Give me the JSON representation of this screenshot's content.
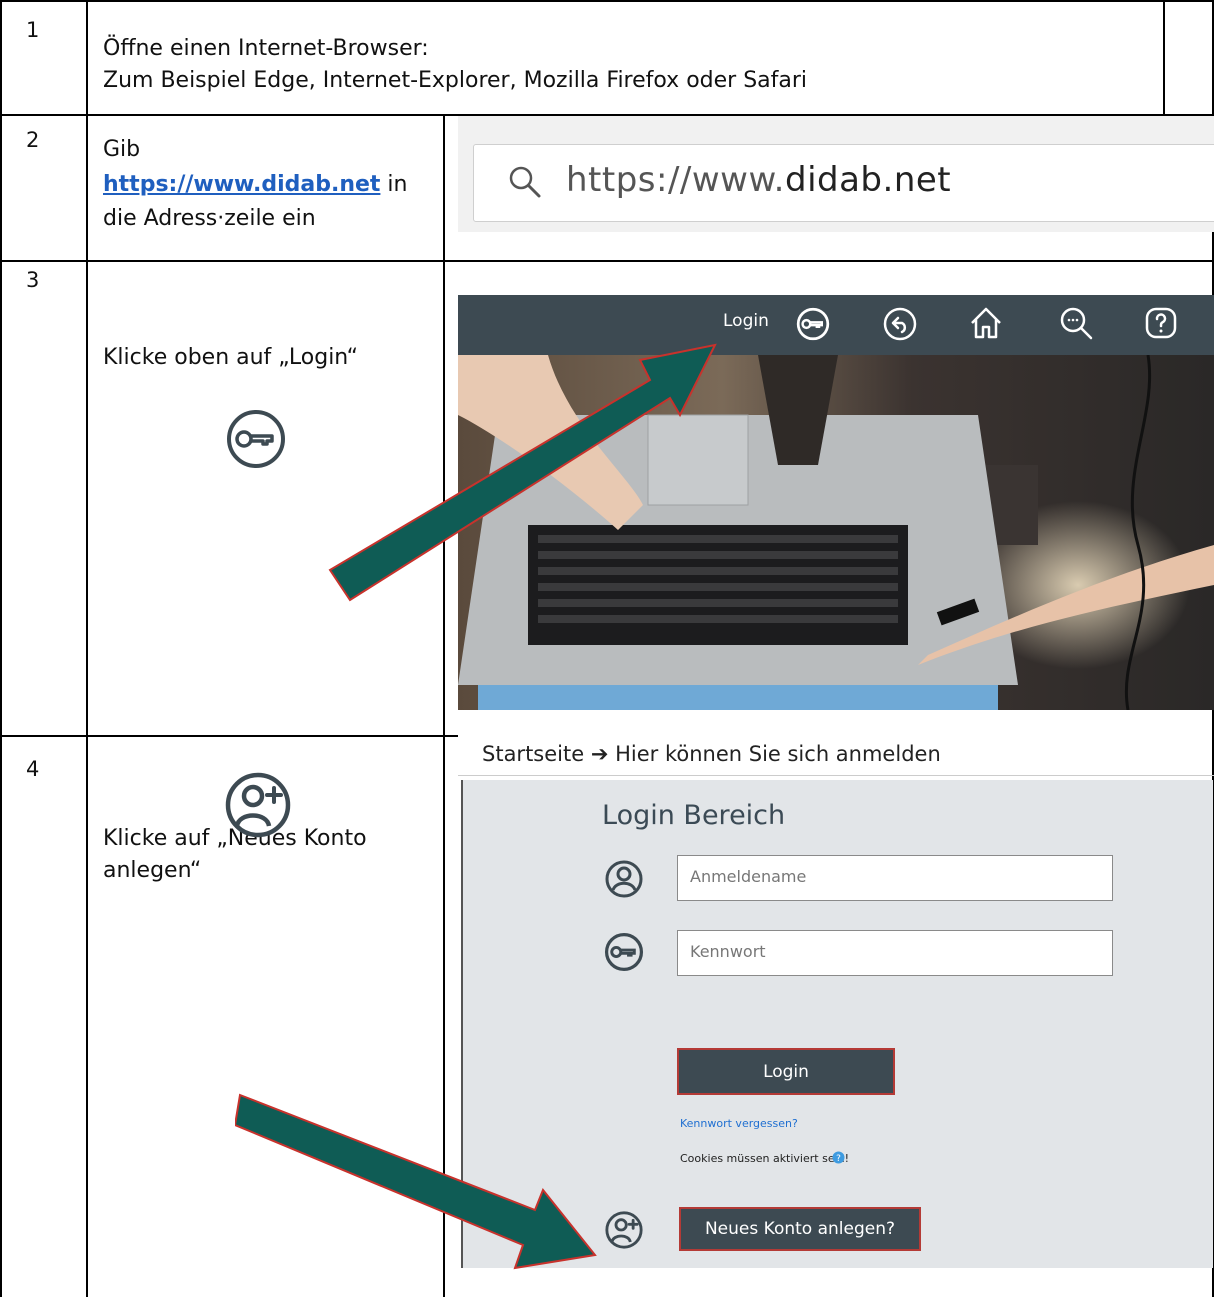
{
  "rows": [
    {
      "num": "1",
      "line1": "Öffne einen Internet-Browser:",
      "line2": "Zum Beispiel Edge, Internet-Explorer, Mozilla Firefox oder Safari"
    },
    {
      "num": "2",
      "pre": "Gib",
      "link": "https://www.didab.net",
      "post1": "in",
      "post2": "die Adress·zeile ein"
    },
    {
      "num": "3",
      "text": "Klicke oben auf „Login“"
    },
    {
      "num": "4",
      "line1": "Klicke auf „Neues Konto",
      "line2": "anlegen“"
    }
  ],
  "address_bar": {
    "prefix": "https://www.",
    "domain": "didab.net"
  },
  "site_nav": {
    "login_label": "Login"
  },
  "login_page": {
    "breadcrumb": "Startseite ➔ Hier können Sie sich anmelden",
    "title": "Login Bereich",
    "username_placeholder": "Anmeldename",
    "password_placeholder": "Kennwort",
    "login_button": "Login",
    "forgot_link": "Kennwort vergessen?",
    "cookies_note": "Cookies müssen aktiviert sein!",
    "new_account_button": "Neues Konto anlegen?"
  },
  "colors": {
    "navbar": "#3d4a52",
    "arrow": "#0f5c55",
    "arrow_outline": "#c8322c",
    "link": "#1f5fbf"
  }
}
